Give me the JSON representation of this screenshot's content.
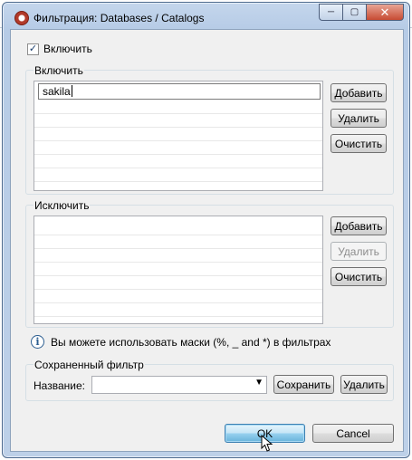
{
  "window": {
    "title": "Фильтрация: Databases / Catalogs",
    "close_glyph": "✕",
    "max_glyph": "▢",
    "min_glyph": "─"
  },
  "enable": {
    "checked": true,
    "check_glyph": "✓",
    "label": "Включить"
  },
  "include": {
    "title": "Включить",
    "items": [
      "sakila"
    ],
    "add_label": "Добавить",
    "remove_label": "Удалить",
    "clear_label": "Очистить"
  },
  "exclude": {
    "title": "Исключить",
    "items": [],
    "add_label": "Добавить",
    "remove_label": "Удалить",
    "clear_label": "Очистить"
  },
  "info": {
    "icon": "info-icon",
    "glyph": "i",
    "text": "Вы можете использовать маски (%, _ and *) в фильтрах"
  },
  "saved": {
    "title": "Сохраненный фильтр",
    "name_label": "Название:",
    "name_value": "",
    "combo_arrow": "▼",
    "save_label": "Сохранить",
    "delete_label": "Удалить"
  },
  "footer": {
    "ok_label": "OK",
    "cancel_label": "Cancel"
  }
}
